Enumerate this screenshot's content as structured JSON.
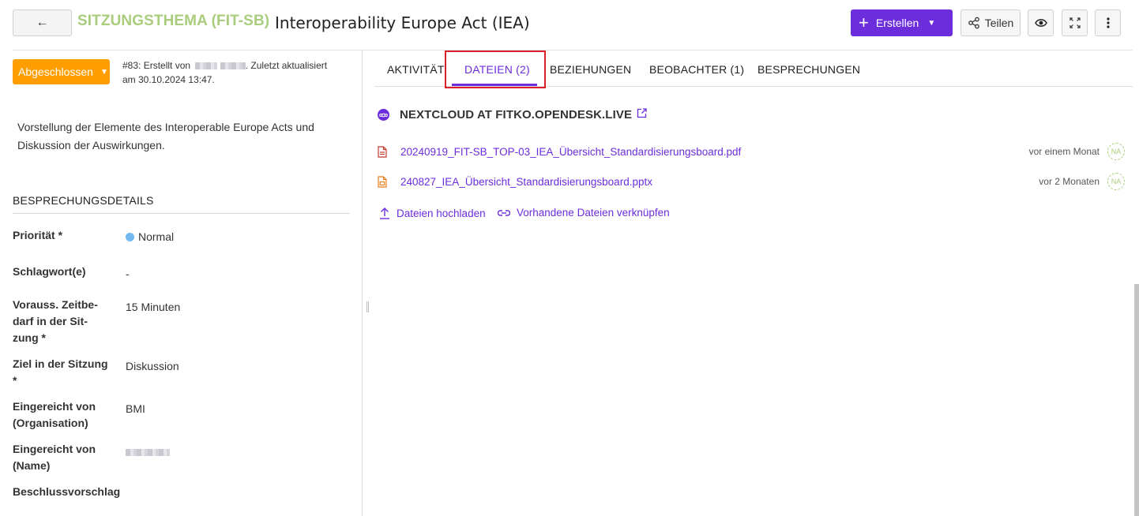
{
  "header": {
    "back_icon": "←",
    "type_label": "SITZUNGSTHEMA (FIT-SB)",
    "title": "Interoperability Europe Act (IEA)",
    "create_label": "Erstellen",
    "share_label": "Teilen",
    "icons": [
      "arrow-left-icon",
      "plus-icon",
      "caret-down-icon",
      "share-icon",
      "eye-icon",
      "fullscreen-icon",
      "more-vertical-icon"
    ]
  },
  "status": {
    "label": "Abgeschlossen",
    "color": "#ff9e00"
  },
  "meta": {
    "prefix": "#83: Erstellt von",
    "middle": ". Zuletzt aktualisiert",
    "date": "am 30.10.2024 13:47."
  },
  "description": "Vorstellung der Elemente des Interoperable Europe Acts und Diskussion der Auswirkungen.",
  "details": {
    "section_title": "BESPRECHUNGSDETAILS",
    "priority": {
      "label": "Priorität *",
      "value": "Normal",
      "color": "#73b9f0"
    },
    "tags": {
      "label": "Schlagwort(e)",
      "value": "-"
    },
    "effort": {
      "label": "Vorauss. Zeitbe-darf in der Sit-zung *",
      "value": "15 Minuten"
    },
    "goal": {
      "label": "Ziel in der Sitzung *",
      "value": "Diskussion"
    },
    "org": {
      "label": "Eingereicht von (Organisation)",
      "value": "BMI"
    },
    "name": {
      "label": "Eingereicht von (Name)"
    },
    "proposal": {
      "label": "Beschlussvorschlag"
    }
  },
  "tabs": [
    {
      "label": "AKTIVITÄT"
    },
    {
      "label": "DATEIEN (2)"
    },
    {
      "label": "BEZIEHUNGEN"
    },
    {
      "label": "BEOBACHTER (1)"
    },
    {
      "label": "BESPRECHUNGEN"
    }
  ],
  "storage": {
    "title": "NEXTCLOUD AT FITKO.OPENDESK.LIVE",
    "files": [
      {
        "name": "20240919_FIT-SB_TOP-03_IEA_Übersicht_Standardisierungsboard.pdf",
        "time": "vor einem Monat",
        "avatar": "NA",
        "icon": "pdf-file-icon",
        "color": "#c0392b"
      },
      {
        "name": "240827_IEA_Übersicht_Standardisierungsboard.pptx",
        "time": "vor 2 Monaten",
        "avatar": "NA",
        "icon": "pptx-file-icon",
        "color": "#e67e22"
      }
    ],
    "upload_label": "Dateien hochladen",
    "link_label": "Vorhandene Dateien verknüpfen"
  },
  "colors": {
    "accent": "#6c2ddc",
    "type_label": "#a9cd7c",
    "highlight": "#d9202b"
  }
}
